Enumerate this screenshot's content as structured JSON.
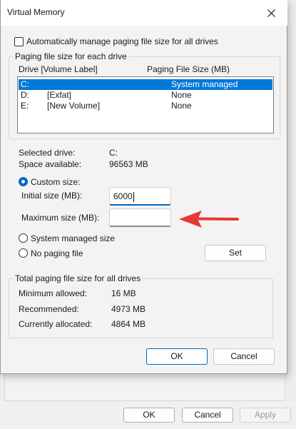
{
  "dialog": {
    "title": "Virtual Memory",
    "auto_manage_label": "Automatically manage paging file size for all drives",
    "auto_manage_checked": false,
    "paging_group_title": "Paging file size for each drive",
    "columns": {
      "drive": "Drive  [Volume Label]",
      "size": "Paging File Size (MB)"
    },
    "drives": [
      {
        "drive": "C:",
        "label": "",
        "size": "System managed",
        "selected": true
      },
      {
        "drive": "D:",
        "label": "[Exfat]",
        "size": "None",
        "selected": false
      },
      {
        "drive": "E:",
        "label": "[New Volume]",
        "size": "None",
        "selected": false
      }
    ],
    "selected_drive_label": "Selected drive:",
    "selected_drive_value": "C:",
    "space_available_label": "Space available:",
    "space_available_value": "96563 MB",
    "custom_size_label": "Custom size:",
    "initial_size_label": "Initial size (MB):",
    "initial_size_value": "6000",
    "maximum_size_label": "Maximum size (MB):",
    "maximum_size_value": "",
    "system_managed_label": "System managed size",
    "no_paging_label": "No paging file",
    "selected_option": "custom",
    "set_label": "Set",
    "total_group_title": "Total paging file size for all drives",
    "minimum_label": "Minimum allowed:",
    "minimum_value": "16 MB",
    "recommended_label": "Recommended:",
    "recommended_value": "4973 MB",
    "allocated_label": "Currently allocated:",
    "allocated_value": "4864 MB",
    "ok_label": "OK",
    "cancel_label": "Cancel"
  },
  "background": {
    "ok_label": "OK",
    "cancel_label": "Cancel",
    "apply_label": "Apply"
  },
  "colors": {
    "accent": "#0067c0",
    "selection": "#0078d7",
    "annotation_arrow": "#e53935"
  },
  "icons": {
    "close": "close-icon",
    "annotation": "red-arrow-icon"
  }
}
